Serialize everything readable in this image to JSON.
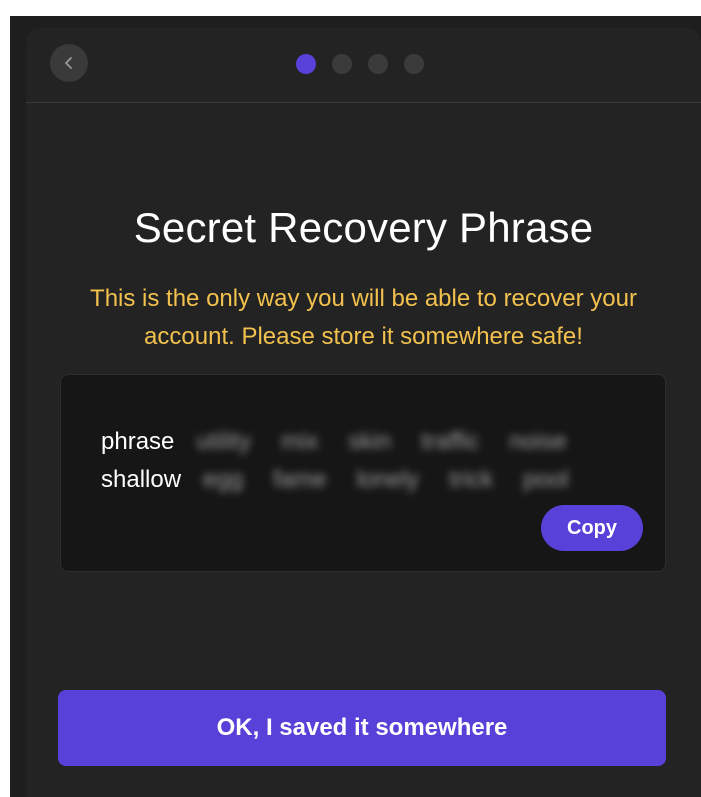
{
  "header": {
    "back_icon": "chevron-left-icon",
    "steps": {
      "total": 4,
      "current": 1
    }
  },
  "main": {
    "title": "Secret Recovery Phrase",
    "warning": "This is the only way you will be able to recover your account. Please store it somewhere safe!",
    "phrase": {
      "line1": {
        "visible": "phrase",
        "hidden": [
          "utility",
          "mix",
          "skin",
          "traffic",
          "noise"
        ]
      },
      "line2": {
        "visible": "shallow",
        "hidden": [
          "egg",
          "fame",
          "lonely",
          "trick",
          "pool"
        ]
      }
    },
    "copy_label": "Copy"
  },
  "footer": {
    "confirm_label": "OK, I saved it somewhere"
  },
  "colors": {
    "accent": "#5741d9",
    "warning": "#f2c14e",
    "background": "#232323"
  }
}
